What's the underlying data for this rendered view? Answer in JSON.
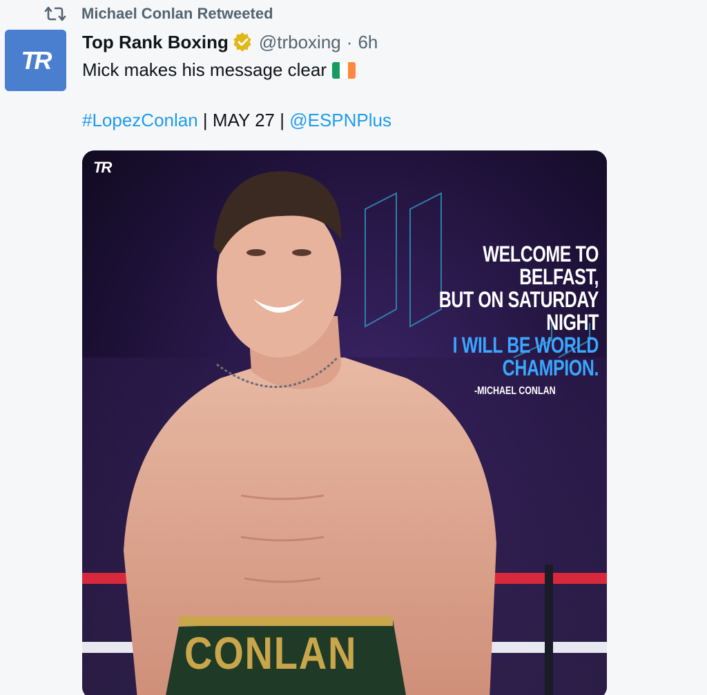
{
  "retweet": {
    "label": "Michael Conlan Retweeted",
    "icon": "retweet-icon"
  },
  "author": {
    "avatar_text": "TR",
    "name": "Top Rank Boxing",
    "verified_icon": "verified-gold-badge-icon",
    "handle": "@trboxing",
    "separator": "·",
    "time": "6h"
  },
  "tweet": {
    "text": "Mick makes his message clear",
    "flag_icon": "ireland-flag-icon",
    "hashtag": "#LopezConlan",
    "sep1": " | ",
    "date": "MAY 27",
    "sep2": " | ",
    "mention": "@ESPNPlus"
  },
  "media": {
    "logo_text": "TR",
    "quote_line1": "WELCOME TO BELFAST,",
    "quote_line2": "BUT ON SATURDAY NIGHT",
    "quote_line3": "I WILL BE WORLD CHAMPION.",
    "attribution": "-MICHAEL CONLAN",
    "shorts_text": "CONLAN"
  },
  "colors": {
    "link": "#1d9bf0",
    "muted": "#536471",
    "text": "#0f1419",
    "avatar_bg": "#4a7fd0",
    "quote_accent": "#3aa6ff",
    "verified_gold": "#e2b719"
  }
}
